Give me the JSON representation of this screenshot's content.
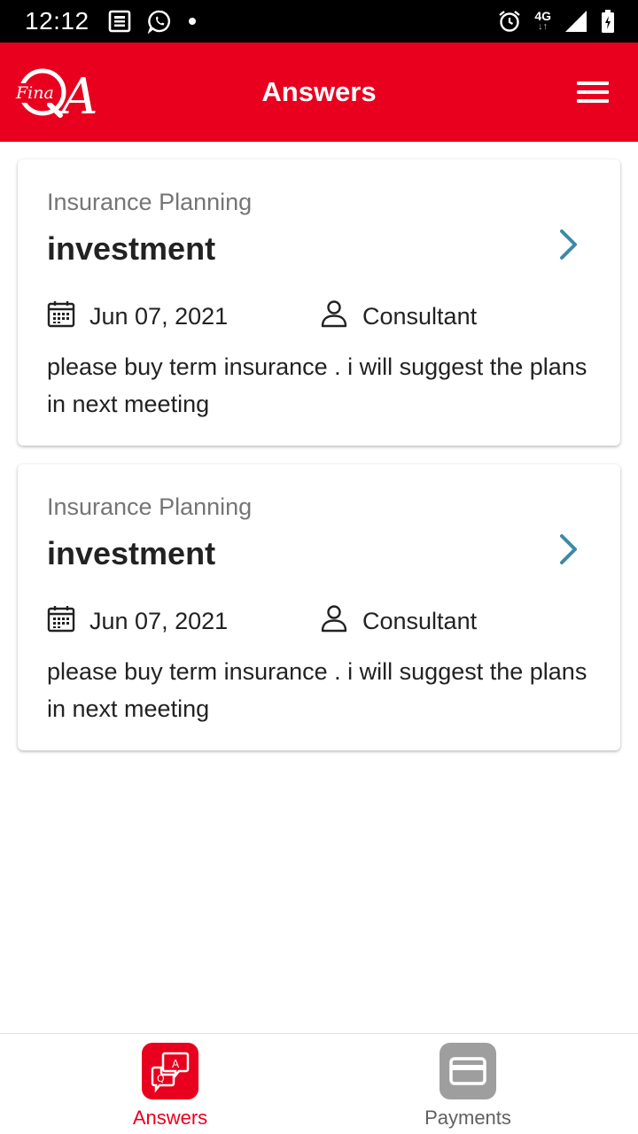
{
  "status_bar": {
    "time": "12:12",
    "network": "4G",
    "network_arrows": "↓↑",
    "left_icons": [
      "news-icon",
      "whatsapp-icon",
      "dot-icon"
    ],
    "right_icons": [
      "alarm-icon",
      "network-4g-icon",
      "signal-icon",
      "battery-icon"
    ]
  },
  "app_bar": {
    "logo_small": "Fina",
    "logo_main": "QA",
    "title": "Answers",
    "menu_icon": "hamburger-menu-icon",
    "background": "#e8001e"
  },
  "answers": [
    {
      "category": "Insurance Planning",
      "title": "investment",
      "date": "Jun 07, 2021",
      "author": "Consultant",
      "body": "please buy term insurance . i will suggest the plans in next meeting"
    },
    {
      "category": "Insurance Planning",
      "title": "investment",
      "date": "Jun 07, 2021",
      "author": "Consultant",
      "body": "please buy term insurance . i will suggest the plans in next meeting"
    }
  ],
  "bottom_nav": {
    "items": [
      {
        "label": "Answers",
        "icon": "qa-chat-icon",
        "active": true
      },
      {
        "label": "Payments",
        "icon": "card-icon",
        "active": false
      }
    ]
  },
  "colors": {
    "accent": "#e8001e",
    "chevron": "#3d8aa8",
    "inactive": "#9e9e9e"
  }
}
